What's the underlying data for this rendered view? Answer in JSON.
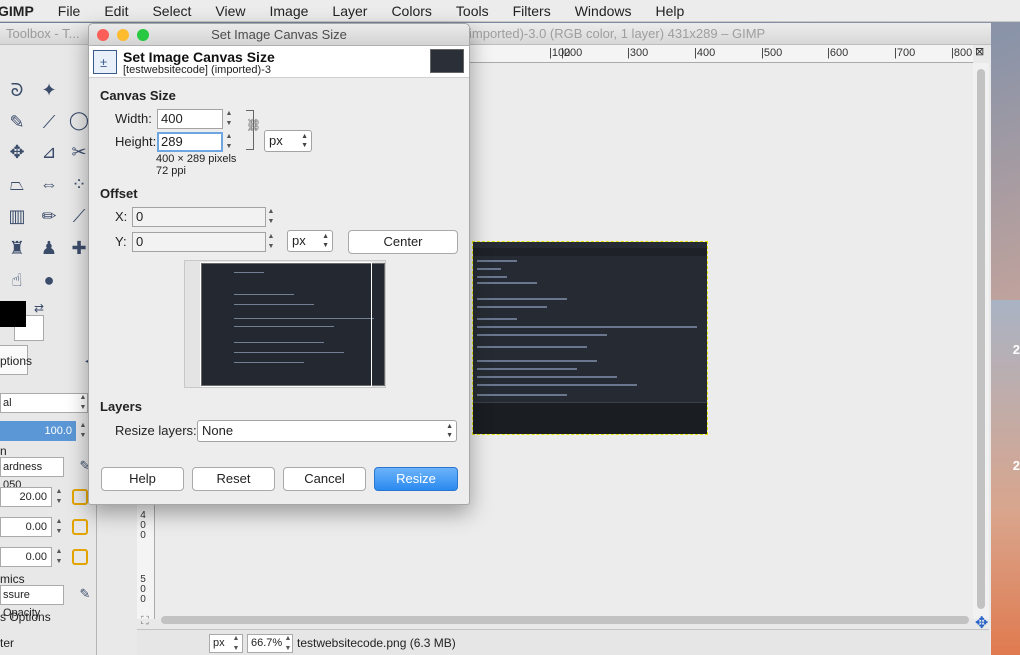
{
  "menubar": {
    "app": "GIMP",
    "items": [
      "File",
      "Edit",
      "Select",
      "View",
      "Image",
      "Layer",
      "Colors",
      "Tools",
      "Filters",
      "Windows",
      "Help"
    ]
  },
  "toolbox": {
    "title": "Toolbox - T...",
    "tab_label": "ptions",
    "mode_value": "al",
    "opacity_value": "100.0",
    "brush_value": "ardness 050",
    "size_value": "20.00",
    "aspect_value": "0.00",
    "angle_value": "0.00",
    "dynamics_label": "mics",
    "dynamics_value": "ssure Opacity",
    "options_label": "s Options",
    "last_label": "ter",
    "h_label": "n"
  },
  "image_window": {
    "title": "imported)-3.0 (RGB color, 1 layer) 431x289 – GIMP",
    "ruler_ticks": [
      "|100",
      "|200",
      "|300",
      "|400",
      "|500",
      "|600",
      "|700",
      "|800"
    ],
    "ruler_left_labels": [
      "4",
      "0",
      "0",
      "5",
      "0",
      "0"
    ],
    "unit": "px",
    "zoom": "66.7%",
    "status": "testwebsitecode.png (6.3 MB)",
    "desktop_labels": [
      "2",
      "2"
    ]
  },
  "dialog": {
    "window_title": "Set Image Canvas Size",
    "header_title": "Set Image Canvas Size",
    "header_subtitle": "[testwebsitecode] (imported)-3",
    "canvas_size_heading": "Canvas Size",
    "width_label": "Width:",
    "width_value": "400",
    "height_label": "Height:",
    "height_value": "289",
    "unit": "px",
    "size_info": "400 × 289 pixels",
    "ppi_info": "72 ppi",
    "offset_heading": "Offset",
    "x_label": "X:",
    "x_value": "0",
    "y_label": "Y:",
    "y_value": "0",
    "offset_unit": "px",
    "center_label": "Center",
    "layers_heading": "Layers",
    "resize_layers_label": "Resize layers:",
    "resize_layers_value": "None",
    "buttons": {
      "help": "Help",
      "reset": "Reset",
      "cancel": "Cancel",
      "resize": "Resize"
    }
  },
  "colors": {
    "accent": "#2a8af0",
    "close": "#fc5f57",
    "minimize": "#fdbc2e",
    "maximize": "#28c840",
    "selection": "#e4e400"
  }
}
